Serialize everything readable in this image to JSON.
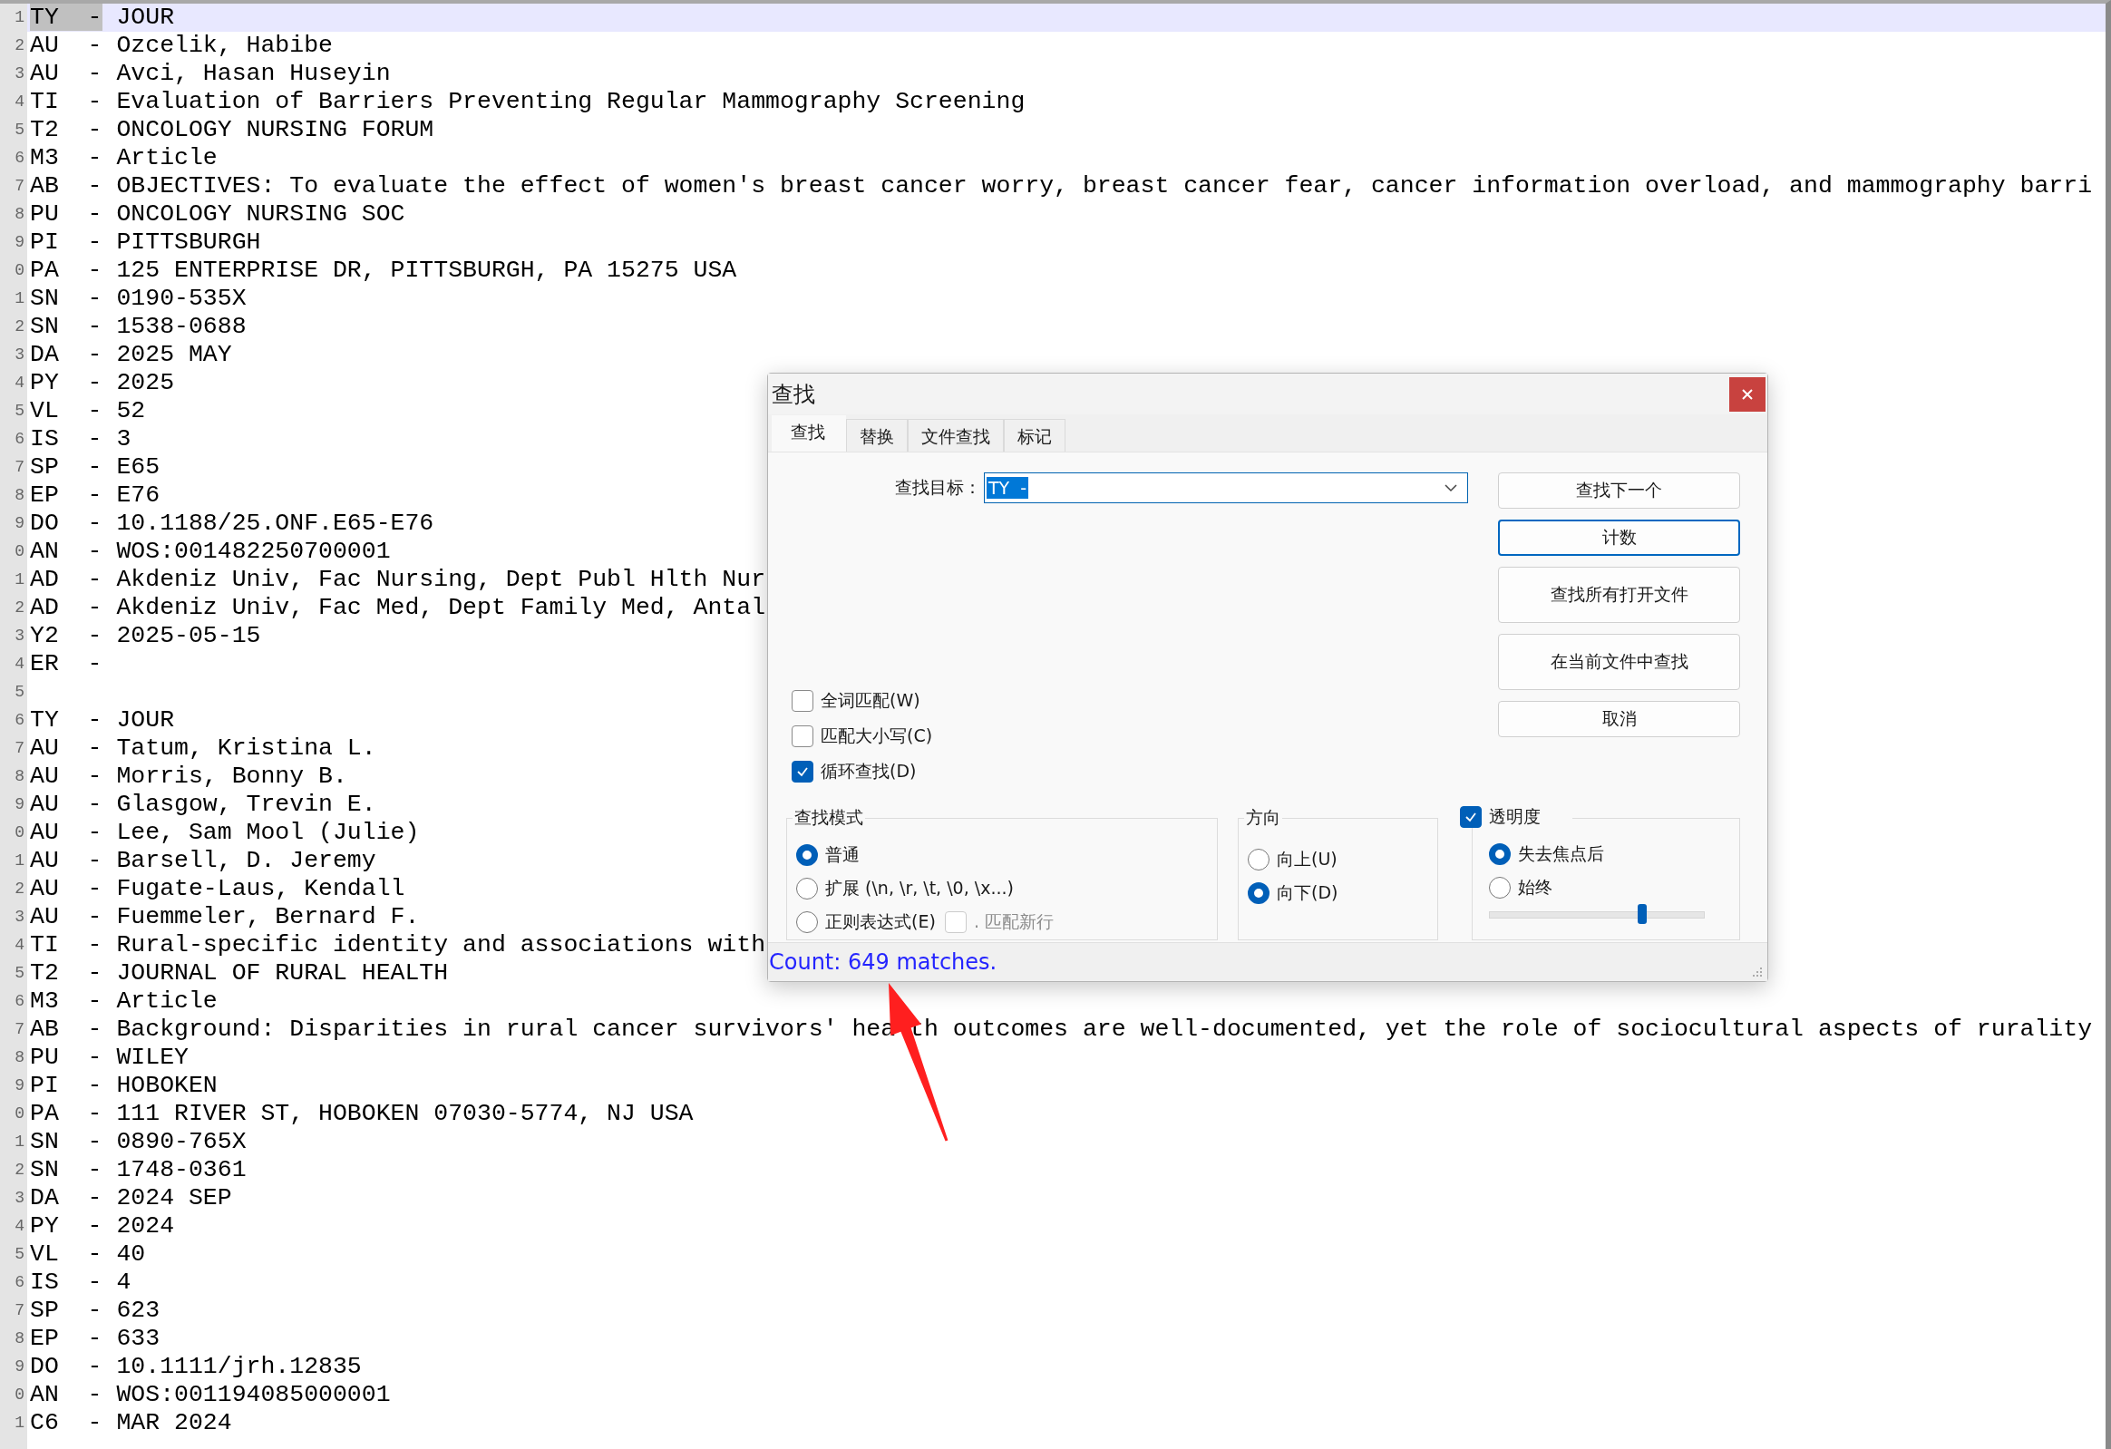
{
  "editor": {
    "lines": [
      {
        "number": "1",
        "tag": "TY  -",
        "text": "JOUR",
        "selected": true
      },
      {
        "number": "2",
        "tag": "AU  -",
        "text": "Ozcelik, Habibe",
        "selected": false
      },
      {
        "number": "3",
        "tag": "AU  -",
        "text": "Avci, Hasan Huseyin",
        "selected": false
      },
      {
        "number": "4",
        "tag": "TI  -",
        "text": "Evaluation of Barriers Preventing Regular Mammography Screening",
        "selected": false
      },
      {
        "number": "5",
        "tag": "T2  -",
        "text": "ONCOLOGY NURSING FORUM",
        "selected": false
      },
      {
        "number": "6",
        "tag": "M3  -",
        "text": "Article",
        "selected": false
      },
      {
        "number": "7",
        "tag": "AB  -",
        "text": "OBJECTIVES: To evaluate the effect of women's breast cancer worry, breast cancer fear, cancer information overload, and mammography barri",
        "selected": false
      },
      {
        "number": "8",
        "tag": "PU  -",
        "text": "ONCOLOGY NURSING SOC",
        "selected": false
      },
      {
        "number": "9",
        "tag": "PI  -",
        "text": "PITTSBURGH",
        "selected": false
      },
      {
        "number": "0",
        "tag": "PA  -",
        "text": "125 ENTERPRISE DR, PITTSBURGH, PA 15275 USA",
        "selected": false
      },
      {
        "number": "1",
        "tag": "SN  -",
        "text": "0190-535X",
        "selected": false
      },
      {
        "number": "2",
        "tag": "SN  -",
        "text": "1538-0688",
        "selected": false
      },
      {
        "number": "3",
        "tag": "DA  -",
        "text": "2025 MAY",
        "selected": false
      },
      {
        "number": "4",
        "tag": "PY  -",
        "text": "2025",
        "selected": false
      },
      {
        "number": "5",
        "tag": "VL  -",
        "text": "52",
        "selected": false
      },
      {
        "number": "6",
        "tag": "IS  -",
        "text": "3",
        "selected": false
      },
      {
        "number": "7",
        "tag": "SP  -",
        "text": "E65",
        "selected": false
      },
      {
        "number": "8",
        "tag": "EP  -",
        "text": "E76",
        "selected": false
      },
      {
        "number": "9",
        "tag": "DO  -",
        "text": "10.1188/25.ONF.E65-E76",
        "selected": false
      },
      {
        "number": "0",
        "tag": "AN  -",
        "text": "WOS:001482250700001",
        "selected": false
      },
      {
        "number": "1",
        "tag": "AD  -",
        "text": "Akdeniz Univ, Fac Nursing, Dept Publ Hlth Nur",
        "selected": false
      },
      {
        "number": "2",
        "tag": "AD  -",
        "text": "Akdeniz Univ, Fac Med, Dept Family Med, Antal",
        "selected": false
      },
      {
        "number": "3",
        "tag": "Y2  -",
        "text": "2025-05-15",
        "selected": false
      },
      {
        "number": "4",
        "tag": "ER  -",
        "selected": false
      },
      {
        "number": "5",
        "selected": false
      },
      {
        "number": "6",
        "tag": "TY  -",
        "text": "JOUR",
        "selected": false
      },
      {
        "number": "7",
        "tag": "AU  -",
        "text": "Tatum, Kristina L.",
        "selected": false
      },
      {
        "number": "8",
        "tag": "AU  -",
        "text": "Morris, Bonny B.",
        "selected": false
      },
      {
        "number": "9",
        "tag": "AU  -",
        "text": "Glasgow, Trevin E.",
        "selected": false
      },
      {
        "number": "0",
        "tag": "AU  -",
        "text": "Lee, Sam Mool (Julie)",
        "selected": false
      },
      {
        "number": "1",
        "tag": "AU  -",
        "text": "Barsell, D. Jeremy",
        "selected": false
      },
      {
        "number": "2",
        "tag": "AU  -",
        "text": "Fugate-Laus, Kendall",
        "selected": false
      },
      {
        "number": "3",
        "tag": "AU  -",
        "text": "Fuemmeler, Bernard F.",
        "selected": false
      },
      {
        "number": "4",
        "tag": "TI  -",
        "text": "Rural-specific identity and associations with",
        "selected": false
      },
      {
        "number": "5",
        "tag": "T2  -",
        "text": "JOURNAL OF RURAL HEALTH",
        "selected": false
      },
      {
        "number": "6",
        "tag": "M3  -",
        "text": "Article",
        "selected": false
      },
      {
        "number": "7",
        "tag": "AB  -",
        "text": "Background: Disparities in rural cancer survivors' hea th outcomes are well-documented, yet the role of sociocultural aspects of rurality",
        "selected": false
      },
      {
        "number": "8",
        "tag": "PU  -",
        "text": "WILEY",
        "selected": false
      },
      {
        "number": "9",
        "tag": "PI  -",
        "text": "HOBOKEN",
        "selected": false
      },
      {
        "number": "0",
        "tag": "PA  -",
        "text": "111 RIVER ST, HOBOKEN 07030-5774, NJ USA",
        "selected": false
      },
      {
        "number": "1",
        "tag": "SN  -",
        "text": "0890-765X",
        "selected": false
      },
      {
        "number": "2",
        "tag": "SN  -",
        "text": "1748-0361",
        "selected": false
      },
      {
        "number": "3",
        "tag": "DA  -",
        "text": "2024 SEP",
        "selected": false
      },
      {
        "number": "4",
        "tag": "PY  -",
        "text": "2024",
        "selected": false
      },
      {
        "number": "5",
        "tag": "VL  -",
        "text": "40",
        "selected": false
      },
      {
        "number": "6",
        "tag": "IS  -",
        "text": "4",
        "selected": false
      },
      {
        "number": "7",
        "tag": "SP  -",
        "text": "623",
        "selected": false
      },
      {
        "number": "8",
        "tag": "EP  -",
        "text": "633",
        "selected": false
      },
      {
        "number": "9",
        "tag": "DO  -",
        "text": "10.1111/jrh.12835",
        "selected": false
      },
      {
        "number": "0",
        "tag": "AN  -",
        "text": "WOS:001194085000001",
        "selected": false
      },
      {
        "number": "1",
        "tag": "C6  -",
        "text": "MAR 2024",
        "selected": false
      }
    ]
  },
  "dialog": {
    "title": "查找",
    "tabs": [
      {
        "label": "查找",
        "selected": true
      },
      {
        "label": "替换",
        "selected": false
      },
      {
        "label": "文件查找",
        "selected": false
      },
      {
        "label": "标记",
        "selected": false
      }
    ],
    "find_what": {
      "label": "查找目标：",
      "value": "TY  -",
      "value_selected": true
    },
    "buttons": [
      {
        "label": "查找下一个",
        "kind": "short",
        "focused": false
      },
      {
        "label": "计数",
        "kind": "short",
        "focused": true
      },
      {
        "label": "查找所有打开文件",
        "kind": "tall",
        "focused": false
      },
      {
        "label": "在当前文件中查找",
        "kind": "tall",
        "focused": false
      },
      {
        "label": "取消",
        "kind": "short",
        "focused": false
      }
    ],
    "options": [
      {
        "label": "全词匹配(W)",
        "checked": false
      },
      {
        "label": "匹配大小写(C)",
        "checked": false
      },
      {
        "label": "循环查找(D)",
        "checked": true
      }
    ],
    "search_mode": {
      "title": "查找模式",
      "options": [
        {
          "label": "普通",
          "selected": true
        },
        {
          "label": "扩展 (\\n, \\r, \\t, \\0, \\x...)",
          "selected": false
        },
        {
          "label": "正则表达式(E)",
          "selected": false
        }
      ],
      "dot_matches_newline": {
        "label": ". 匹配新行",
        "checked": false,
        "disabled": true
      }
    },
    "direction": {
      "title": "方向",
      "options": [
        {
          "label": "向上(U)",
          "selected": false
        },
        {
          "label": "向下(D)",
          "selected": true
        }
      ]
    },
    "transparency": {
      "label": "透明度",
      "checked": true,
      "options": [
        {
          "label": "失去焦点后",
          "selected": true
        },
        {
          "label": "始终",
          "selected": false
        }
      ],
      "level": 0.71
    },
    "status": "Count: 649 matches."
  }
}
